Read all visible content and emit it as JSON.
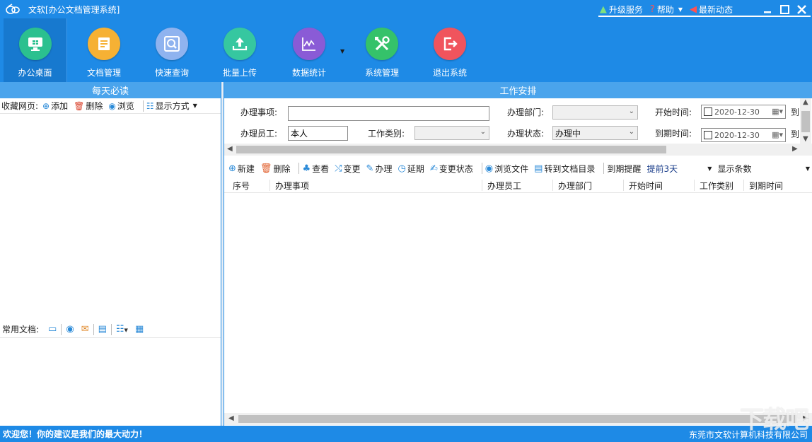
{
  "window": {
    "title": "文软[办公文档管理系统]",
    "upgrade": "升级服务",
    "help": "帮助",
    "news": "最新动态"
  },
  "toolbar": [
    {
      "label": "办公桌面",
      "icon": "monitor-icon",
      "color": "#2bc08f"
    },
    {
      "label": "文档管理",
      "icon": "document-stack-icon",
      "color": "#f6b134"
    },
    {
      "label": "快速查询",
      "icon": "search-screen-icon",
      "color": "#8fb3ef"
    },
    {
      "label": "批量上传",
      "icon": "upload-icon",
      "color": "#36c7a0"
    },
    {
      "label": "数据统计",
      "icon": "chart-icon",
      "color": "#8a5bd6"
    },
    {
      "label": "系统管理",
      "icon": "tools-icon",
      "color": "#35c26a"
    },
    {
      "label": "退出系统",
      "icon": "exit-icon",
      "color": "#f0545d"
    }
  ],
  "left": {
    "header": "每天必读",
    "fav_label": "收藏网页:",
    "add": "添加",
    "delete": "删除",
    "browse": "浏览",
    "display_mode": "显示方式",
    "docs_label": "常用文档:"
  },
  "right": {
    "header": "工作安排",
    "form": {
      "item_label": "办理事项:",
      "item_value": "",
      "dept_label": "办理部门:",
      "dept_value": "",
      "start_label": "开始时间:",
      "start_value": "2020-12-30",
      "start_suffix": "到",
      "staff_label": "办理员工:",
      "staff_value": "本人",
      "type_label": "工作类别:",
      "type_value": "",
      "status_label": "办理状态:",
      "status_value": "办理中",
      "due_label": "到期时间:",
      "due_value": "2020-12-30",
      "due_suffix": "到"
    },
    "actions": {
      "new": "新建",
      "delete": "删除",
      "view": "查看",
      "change": "变更",
      "handle": "办理",
      "extend": "延期",
      "change_status": "变更状态",
      "browse_file": "浏览文件",
      "goto_catalog": "转到文档目录",
      "remind_label": "到期提醒",
      "remind_value": "提前3天",
      "show_count": "显示条数"
    },
    "columns": [
      "序号",
      "办理事项",
      "办理员工",
      "办理部门",
      "开始时间",
      "工作类别",
      "到期时间"
    ]
  },
  "status": {
    "left": "欢迎您！你的建议是我们的最大动力！",
    "right": "东莞市文软计算机科技有限公司"
  },
  "watermark": "下载吧"
}
